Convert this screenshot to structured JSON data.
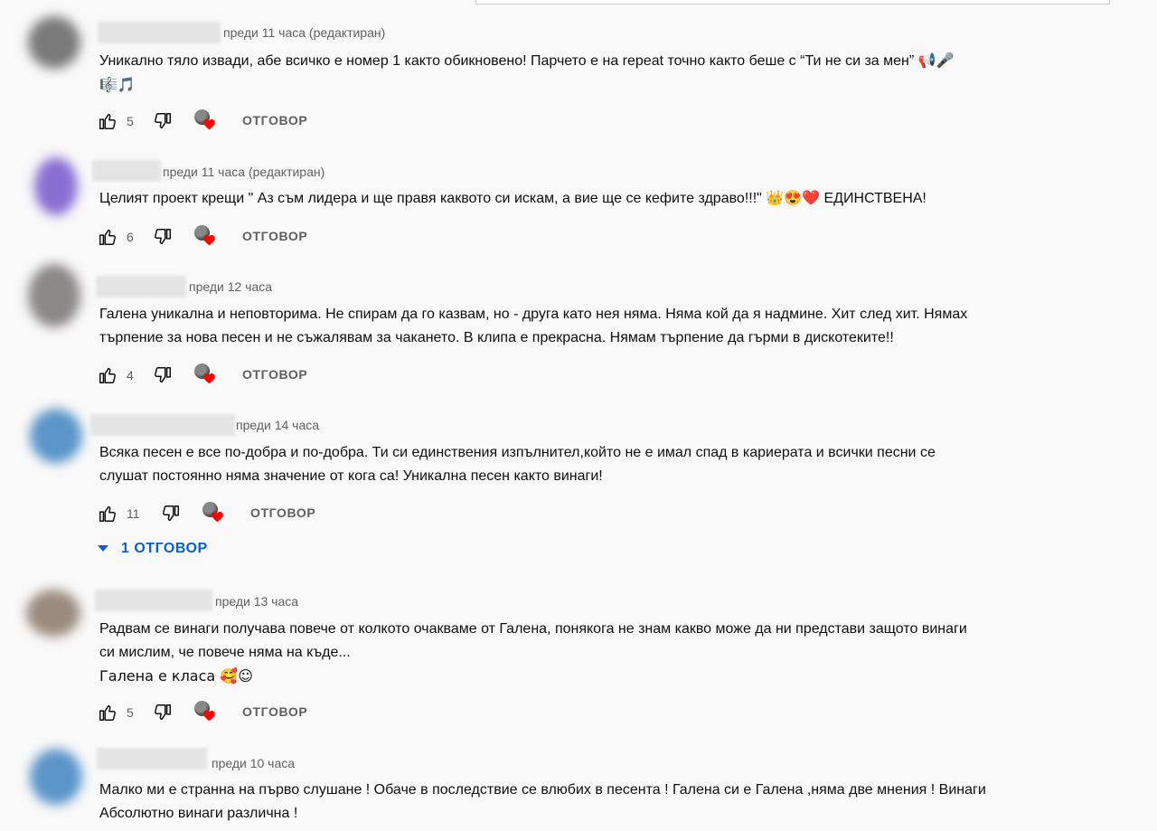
{
  "reply_label": "ОТГОВОР",
  "comments": [
    {
      "time": "преди 11 часа (редактиран)",
      "lines": [
        "Уникално тяло извади, абе всичко е номер 1 както обикновено! Парчето е на repeat точно както беше с “Ти не си за мен” 📢🎤",
        "🎼🎵"
      ],
      "likes": "5"
    },
    {
      "time": "преди 11 часа (редактиран)",
      "lines": [
        "Целият проект крещи \" Аз съм лидера и ще правя каквото си искам, а вие ще се кефите здраво!!!\" 👑😍❤️ ЕДИНСТВЕНА!"
      ],
      "likes": "6"
    },
    {
      "time": "преди 12 часа",
      "lines": [
        "Галена уникална и неповторима. Не спирам да го казвам, но - друга като нея няма. Няма кой да я надмине. Хит след хит. Нямах",
        "търпение за нова песен и не съжалявам за чакането. В клипа е прекрасна. Нямам търпение да гърми в дискотеките!!"
      ],
      "likes": "4"
    },
    {
      "time": "преди 14 часа",
      "lines": [
        "Всяка песен е все по-добра и по-добра. Ти си единствения изпълнител,който не е имал спад в кариерата и всички песни се",
        "слушат постоянно няма значение от кога са! Уникална песен както винаги!"
      ],
      "likes": "11",
      "replies_label": "1 ОТГОВОР"
    },
    {
      "time": "преди 13 часа",
      "lines": [
        "Радвам се винаги получава повече от колкото очакваме от Галена, понякога не знам какво може да ни представи защото винаги",
        "си мислим, че повече няма на къде...",
        "Галена  е класа 🥰☺"
      ],
      "likes": "5"
    },
    {
      "time": "преди 10 часа",
      "lines": [
        "Малко ми е странна на първо слушане ! Обаче в последствие се влюбих в песента ! Галена си е Галена ,няма две мнения ! Винаги",
        "Абсолютно винаги различна !"
      ]
    }
  ],
  "colors": {
    "link": "#065fd4",
    "heart": "#ff0000",
    "meta": "#606060"
  }
}
